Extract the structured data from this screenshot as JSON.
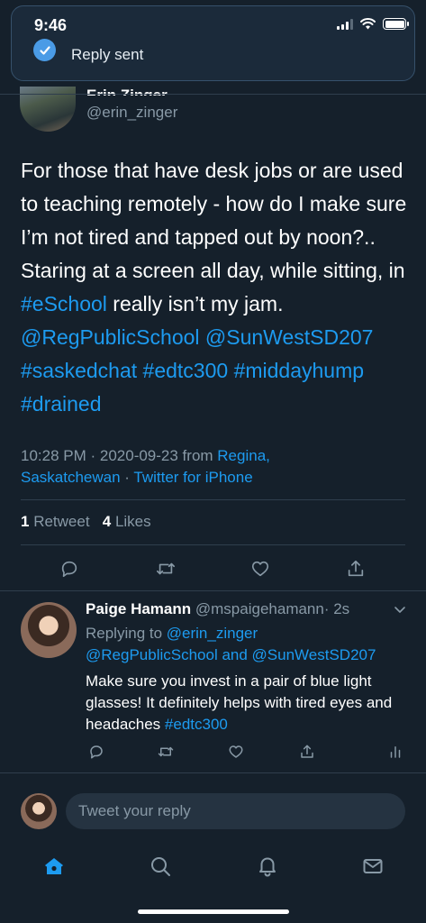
{
  "status_bar": {
    "time": "9:46"
  },
  "toast": {
    "text": "Reply sent"
  },
  "tweet": {
    "author_name": "Erin Zinger",
    "handle": "@erin_zinger",
    "text_parts": [
      {
        "text": "For those that have desk jobs or are used to teaching remotely - how do I make sure I’m not tired and tapped out by noon?.. Staring at a screen all day, while sitting, in ",
        "link": false
      },
      {
        "text": "#eSchool",
        "link": true
      },
      {
        "text": " really isn’t my jam. ",
        "link": false
      },
      {
        "text": "@RegPublicSchool",
        "link": true
      },
      {
        "text": " ",
        "link": false
      },
      {
        "text": "@SunWestSD207",
        "link": true
      },
      {
        "text": " ",
        "link": false
      },
      {
        "text": "#saskedchat",
        "link": true
      },
      {
        "text": " ",
        "link": false
      },
      {
        "text": "#edtc300",
        "link": true
      },
      {
        "text": " ",
        "link": false
      },
      {
        "text": "#middayhump",
        "link": true
      },
      {
        "text": " ",
        "link": false
      },
      {
        "text": "#drained",
        "link": true
      }
    ],
    "timestamp": "10:28 PM · 2020-09-23 from ",
    "location": "Regina, Saskatchewan",
    "separator": " · ",
    "client": "Twitter for iPhone",
    "retweets": "1",
    "retweets_label": "Retweet",
    "likes": "4",
    "likes_label": "Likes"
  },
  "reply": {
    "name": "Paige Hamann",
    "handle": "@mspaigehamann",
    "time": "· 2s",
    "replying_prefix": "Replying to ",
    "replying_to_1": "@erin_zinger",
    "replying_to_2": "@RegPublicSchool",
    "replying_and": " and ",
    "replying_to_3": "@SunWestSD207",
    "text": "Make sure you invest in a pair of blue light glasses! It definitely helps with tired eyes and headaches ",
    "hashtag": "#edtc300"
  },
  "compose": {
    "placeholder": "Tweet your reply"
  },
  "icons": {
    "toast": "checkmark-icon",
    "actions": [
      "reply-icon",
      "retweet-icon",
      "like-icon",
      "share-icon"
    ],
    "reply_actions": [
      "reply-icon",
      "retweet-icon",
      "like-icon",
      "share-icon",
      "analytics-icon"
    ],
    "tabs": [
      "home-icon",
      "search-icon",
      "notifications-icon",
      "messages-icon"
    ]
  },
  "colors": {
    "background": "#15202b",
    "accent": "#1d9bf0",
    "muted": "#8899a6",
    "divider": "#2f3e4d"
  }
}
